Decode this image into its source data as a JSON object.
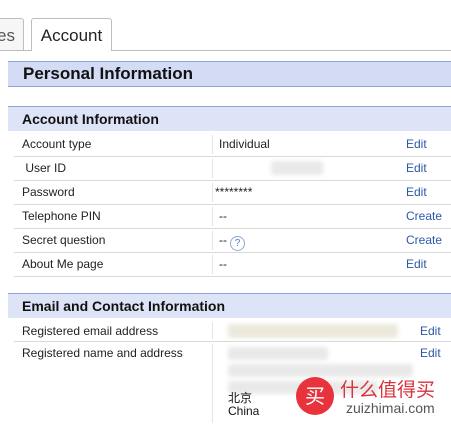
{
  "tabs": [
    {
      "label": "es"
    },
    {
      "label": "Account"
    }
  ],
  "page_title": "Personal Information",
  "account_section": {
    "title": "Account Information",
    "rows": [
      {
        "label": "Account type",
        "value": "Individual",
        "action": "Edit"
      },
      {
        "label": " User ID",
        "value": "",
        "action": "Edit"
      },
      {
        "label": "Password",
        "value": "********",
        "action": "Edit"
      },
      {
        "label": "Telephone PIN",
        "value": "--",
        "action": "Create"
      },
      {
        "label": "Secret question",
        "value": "--",
        "action": "Create"
      },
      {
        "label": "About Me page",
        "value": "--",
        "action": "Edit"
      }
    ]
  },
  "contact_section": {
    "title": "Email and Contact Information",
    "rows": [
      {
        "label": "Registered email address",
        "action": "Edit"
      },
      {
        "label": "Registered name and address",
        "action": "Edit"
      }
    ],
    "address_lines": [
      "北京",
      "China"
    ]
  },
  "help_glyph": "?",
  "watermark": {
    "badge": "买",
    "cn": "什么值得买",
    "en": "zuizhimai.com"
  },
  "colors": {
    "link": "#2a57a8",
    "header_bg": "#d4dcf5",
    "header_border": "#8ea3d9"
  }
}
